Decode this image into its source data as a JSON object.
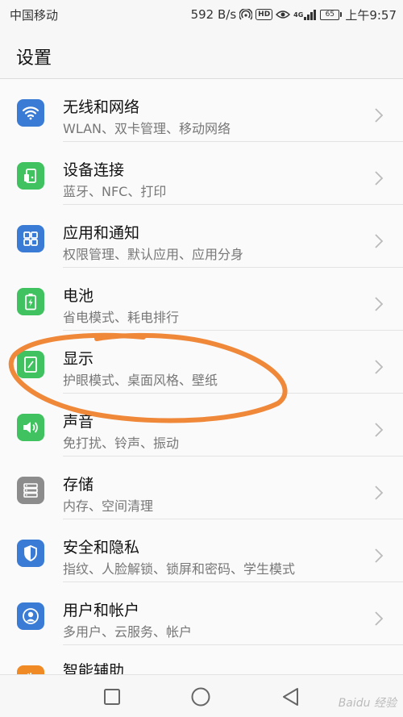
{
  "status_bar": {
    "carrier": "中国移动",
    "speed": "592 B/s",
    "hd": "HD",
    "signal": "4G",
    "battery": "65",
    "time": "上午9:57"
  },
  "header": {
    "title": "设置"
  },
  "settings_items": [
    {
      "title": "无线和网络",
      "subtitle": "WLAN、双卡管理、移动网络",
      "icon": "wifi-icon",
      "color": "#3a7bd5"
    },
    {
      "title": "设备连接",
      "subtitle": "蓝牙、NFC、打印",
      "icon": "device-connect-icon",
      "color": "#3fc25f"
    },
    {
      "title": "应用和通知",
      "subtitle": "权限管理、默认应用、应用分身",
      "icon": "apps-grid-icon",
      "color": "#3a7bd5"
    },
    {
      "title": "电池",
      "subtitle": "省电模式、耗电排行",
      "icon": "battery-icon",
      "color": "#3fc25f"
    },
    {
      "title": "显示",
      "subtitle": "护眼模式、桌面风格、壁纸",
      "icon": "display-icon",
      "color": "#3fc25f"
    },
    {
      "title": "声音",
      "subtitle": "免打扰、铃声、振动",
      "icon": "speaker-icon",
      "color": "#3fc25f"
    },
    {
      "title": "存储",
      "subtitle": "内存、空间清理",
      "icon": "storage-icon",
      "color": "#8c8c8c"
    },
    {
      "title": "安全和隐私",
      "subtitle": "指纹、人脸解锁、锁屏和密码、学生模式",
      "icon": "shield-icon",
      "color": "#3a7bd5"
    },
    {
      "title": "用户和帐户",
      "subtitle": "多用户、云服务、帐户",
      "icon": "user-icon",
      "color": "#3a7bd5"
    },
    {
      "title": "智能辅助",
      "subtitle": "",
      "icon": "assist-icon",
      "color": "#f08a24"
    }
  ],
  "watermark": "Baidu 经验",
  "colors": {
    "annotation": "#f0883a"
  }
}
